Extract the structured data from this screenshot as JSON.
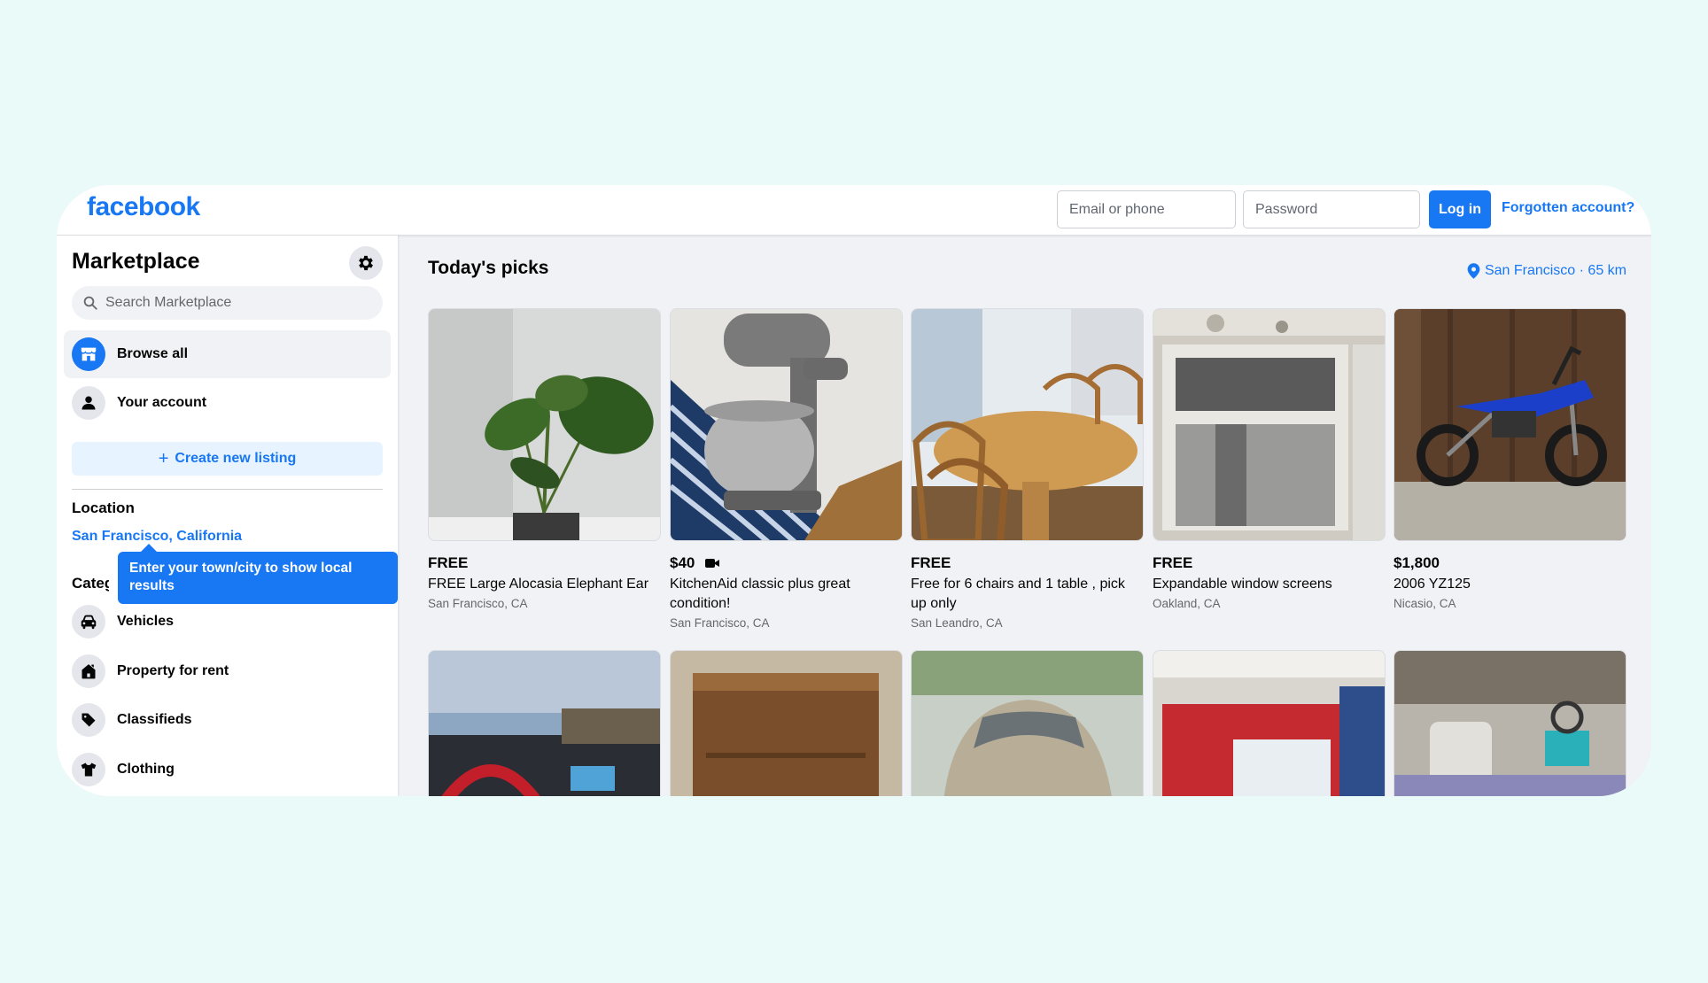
{
  "header": {
    "logo": "facebook",
    "email_placeholder": "Email or phone",
    "password_placeholder": "Password",
    "login_label": "Log in",
    "forgot_label": "Forgotten account?"
  },
  "sidebar": {
    "title": "Marketplace",
    "search_placeholder": "Search Marketplace",
    "nav": [
      {
        "label": "Browse all",
        "icon": "storefront-icon"
      },
      {
        "label": "Your account",
        "icon": "person-icon"
      }
    ],
    "create_label": "Create new listing",
    "location_heading": "Location",
    "location_value": "San Francisco, California",
    "tooltip": "Enter your town/city to show local results",
    "categories_heading": "Categories",
    "categories": [
      {
        "label": "Vehicles",
        "icon": "car-icon"
      },
      {
        "label": "Property for rent",
        "icon": "house-icon"
      },
      {
        "label": "Classifieds",
        "icon": "tag-icon"
      },
      {
        "label": "Clothing",
        "icon": "shirt-icon"
      }
    ]
  },
  "main": {
    "title": "Today's picks",
    "location": "San Francisco · 65 km",
    "listings": [
      {
        "price": "FREE",
        "title": "FREE Large Alocasia Elephant Ear",
        "location": "San Francisco, CA",
        "video": false
      },
      {
        "price": "$40",
        "title": "KitchenAid classic plus great condition!",
        "location": "San Francisco, CA",
        "video": true
      },
      {
        "price": "FREE",
        "title": "Free for 6 chairs and 1 table , pick up only",
        "location": "San Leandro, CA",
        "video": false
      },
      {
        "price": "FREE",
        "title": "Expandable window screens",
        "location": "Oakland, CA",
        "video": false
      },
      {
        "price": "$1,800",
        "title": "2006 YZ125",
        "location": "Nicasio, CA",
        "video": false
      }
    ]
  },
  "colors": {
    "brand": "#1877f2",
    "page_bg": "#eafaf9",
    "content_bg": "#f0f2f5"
  }
}
